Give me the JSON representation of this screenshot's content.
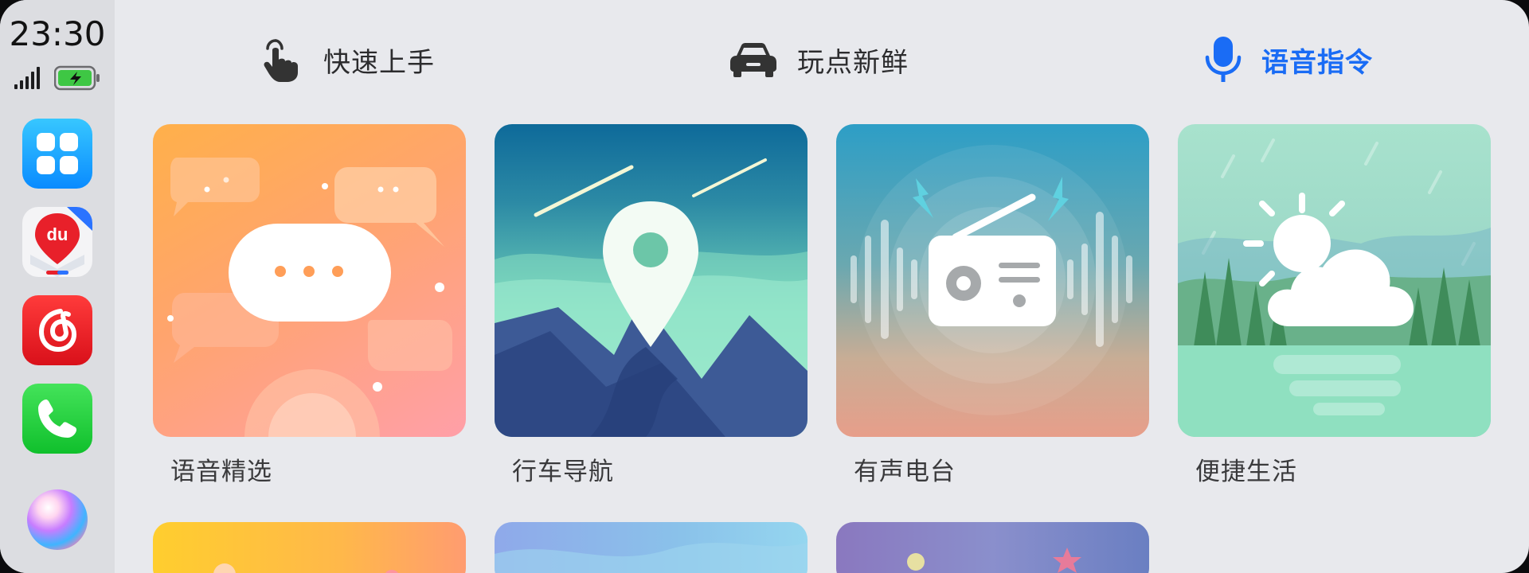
{
  "status": {
    "time": "23:30",
    "icons": [
      "signal-icon",
      "battery-charging-icon"
    ]
  },
  "dock": {
    "apps": [
      {
        "name": "apps-grid",
        "icon": "grid-icon"
      },
      {
        "name": "baidu-maps",
        "icon": "map-pin-icon",
        "badge_text": "du"
      },
      {
        "name": "netease-music",
        "icon": "music-icon"
      },
      {
        "name": "phone",
        "icon": "phone-icon"
      },
      {
        "name": "siri",
        "icon": "siri-icon"
      }
    ]
  },
  "tabs": [
    {
      "label": "快速上手",
      "icon": "tap-hand-icon",
      "active": false
    },
    {
      "label": "玩点新鲜",
      "icon": "car-icon",
      "active": false
    },
    {
      "label": "语音指令",
      "icon": "microphone-icon",
      "active": true
    }
  ],
  "colors": {
    "accent": "#1a6cf5",
    "background": "#e8e9ed",
    "sidebar": "#dcdde1"
  },
  "cards": [
    {
      "label": "语音精选",
      "icon": "chat-bubble-icon"
    },
    {
      "label": "行车导航",
      "icon": "location-pin-icon"
    },
    {
      "label": "有声电台",
      "icon": "radio-icon"
    },
    {
      "label": "便捷生活",
      "icon": "weather-icon"
    }
  ]
}
